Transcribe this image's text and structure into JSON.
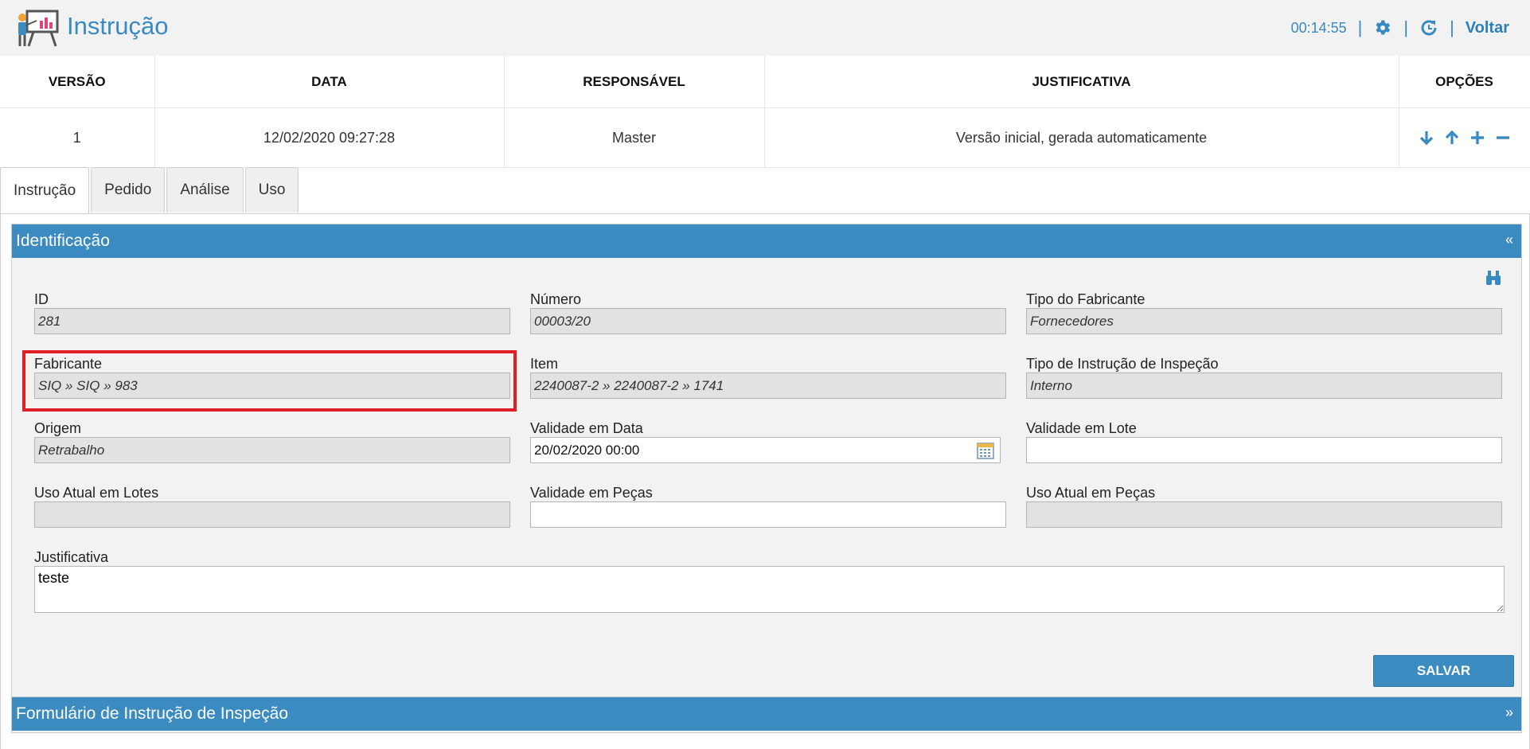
{
  "header": {
    "title": "Instrução",
    "timer": "00:14:55",
    "separator": "|",
    "back_label": "Voltar",
    "icons": {
      "app": "presentation-board-icon",
      "settings": "gear-icon",
      "refresh": "refresh-icon"
    }
  },
  "versions_table": {
    "headers": [
      "VERSÃO",
      "DATA",
      "RESPONSÁVEL",
      "JUSTIFICATIVA",
      "OPÇÕES"
    ],
    "rows": [
      {
        "versao": "1",
        "data": "12/02/2020 09:27:28",
        "responsavel": "Master",
        "justificativa": "Versão inicial, gerada automaticamente"
      }
    ],
    "option_icons": [
      "arrow-down-icon",
      "arrow-up-icon",
      "plus-icon",
      "minus-icon"
    ]
  },
  "tabs": [
    {
      "label": "Instrução",
      "active": true
    },
    {
      "label": "Pedido",
      "active": false
    },
    {
      "label": "Análise",
      "active": false
    },
    {
      "label": "Uso",
      "active": false
    }
  ],
  "identificacao": {
    "title": "Identificação",
    "toggle": "«",
    "fields": {
      "id": {
        "label": "ID",
        "value": "281"
      },
      "numero": {
        "label": "Número",
        "value": "00003/20"
      },
      "tipo_fabricante": {
        "label": "Tipo do Fabricante",
        "value": "Fornecedores"
      },
      "fabricante": {
        "label": "Fabricante",
        "value": "SIQ » SIQ » 983"
      },
      "item": {
        "label": "Item",
        "value": "2240087-2 » 2240087-2 » 1741"
      },
      "tipo_instrucao": {
        "label": "Tipo de Instrução de Inspeção",
        "value": "Interno"
      },
      "origem": {
        "label": "Origem",
        "value": "Retrabalho"
      },
      "validade_data": {
        "label": "Validade em Data",
        "value": "20/02/2020 00:00"
      },
      "validade_lote": {
        "label": "Validade em Lote",
        "value": ""
      },
      "uso_lotes": {
        "label": "Uso Atual em Lotes",
        "value": ""
      },
      "validade_pecas": {
        "label": "Validade em Peças",
        "value": ""
      },
      "uso_pecas": {
        "label": "Uso Atual em Peças",
        "value": ""
      },
      "justificativa": {
        "label": "Justificativa",
        "value": "teste"
      }
    },
    "save_label": "SALVAR"
  },
  "formulario": {
    "title": "Formulário de Instrução de Inspeção",
    "toggle": "»"
  },
  "colors": {
    "accent": "#3b8bc0",
    "highlight": "#e01e26",
    "readonly_bg": "#e2e2e2",
    "panel_bg": "#f2f2f2"
  }
}
